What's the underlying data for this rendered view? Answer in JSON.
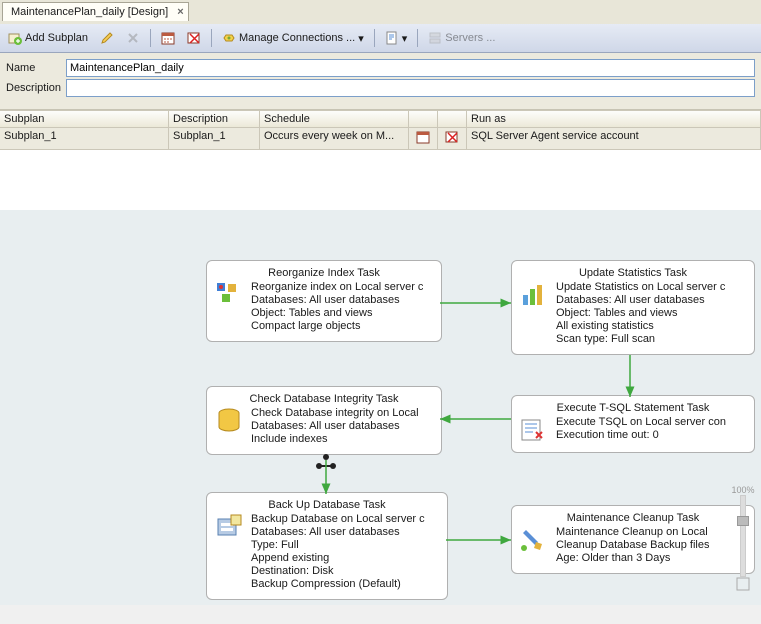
{
  "tab": {
    "title": "MaintenancePlan_daily [Design]"
  },
  "toolbar": {
    "add_subplan": "Add Subplan",
    "manage_conn": "Manage Connections ...",
    "servers": "Servers ..."
  },
  "props": {
    "name_label": "Name",
    "name_value": "MaintenancePlan_daily",
    "desc_label": "Description",
    "desc_value": ""
  },
  "grid": {
    "headers": {
      "subplan": "Subplan",
      "description": "Description",
      "schedule": "Schedule",
      "run_as": "Run as"
    },
    "row": {
      "subplan": "Subplan_1",
      "description": "Subplan_1",
      "schedule": "Occurs every week on M...",
      "run_as": "SQL Server Agent service account"
    }
  },
  "tasks": {
    "reorg": {
      "title": "Reorganize Index Task",
      "text": "Reorganize index on Local server c\nDatabases: All user databases\nObject: Tables and views\nCompact large objects"
    },
    "stats": {
      "title": "Update Statistics Task",
      "text": "Update Statistics on Local server c\nDatabases: All user databases\nObject: Tables and views\nAll existing statistics\nScan type: Full scan"
    },
    "integrity": {
      "title": "Check Database Integrity Task",
      "text": "Check Database integrity on Local\nDatabases: All user databases\nInclude indexes"
    },
    "tsql": {
      "title": "Execute T-SQL Statement Task",
      "text": "Execute TSQL on Local server con\nExecution time out: 0"
    },
    "backup": {
      "title": "Back Up Database Task",
      "text": "Backup Database on Local server c\nDatabases: All user databases\nType: Full\nAppend existing\nDestination: Disk\nBackup Compression (Default)"
    },
    "cleanup": {
      "title": "Maintenance Cleanup Task",
      "text": "Maintenance Cleanup on Local\nCleanup Database Backup files\nAge: Older than 3 Days"
    }
  },
  "zoom_label": "100%"
}
